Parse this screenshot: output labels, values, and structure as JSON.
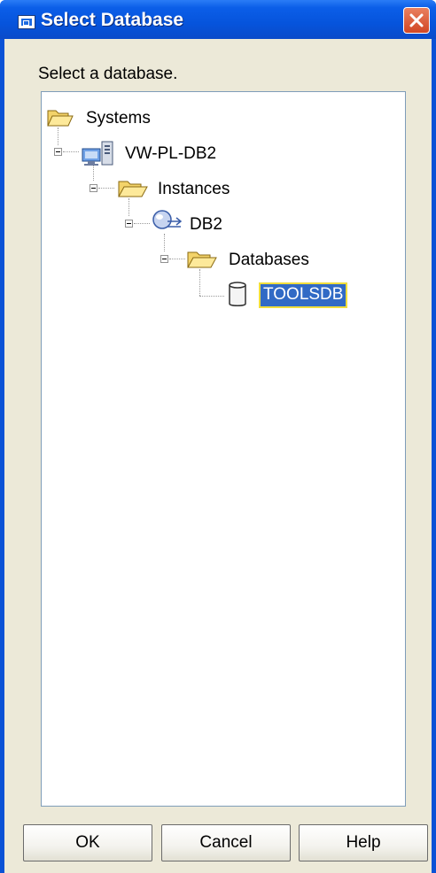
{
  "window": {
    "title": "Select Database",
    "close_icon": "close-icon",
    "app_icon": "console-icon"
  },
  "prompt": "Select a database.",
  "tree": {
    "root": {
      "label": "Systems",
      "icon": "folder-open-icon"
    },
    "system": {
      "label": "VW-PL-DB2",
      "icon": "computer-icon"
    },
    "instances": {
      "label": "Instances",
      "icon": "folder-open-icon"
    },
    "instance": {
      "label": "DB2",
      "icon": "instance-icon"
    },
    "databases": {
      "label": "Databases",
      "icon": "folder-open-icon"
    },
    "database": {
      "label": "TOOLSDB",
      "icon": "database-icon",
      "selected": true
    }
  },
  "buttons": {
    "ok": "OK",
    "cancel": "Cancel",
    "help": "Help"
  },
  "colors": {
    "title_bar": "#0654dc",
    "dialog_bg": "#ece9d8",
    "selection": "#316ac5",
    "focus": "#f1de3c",
    "close": "#d14725"
  }
}
